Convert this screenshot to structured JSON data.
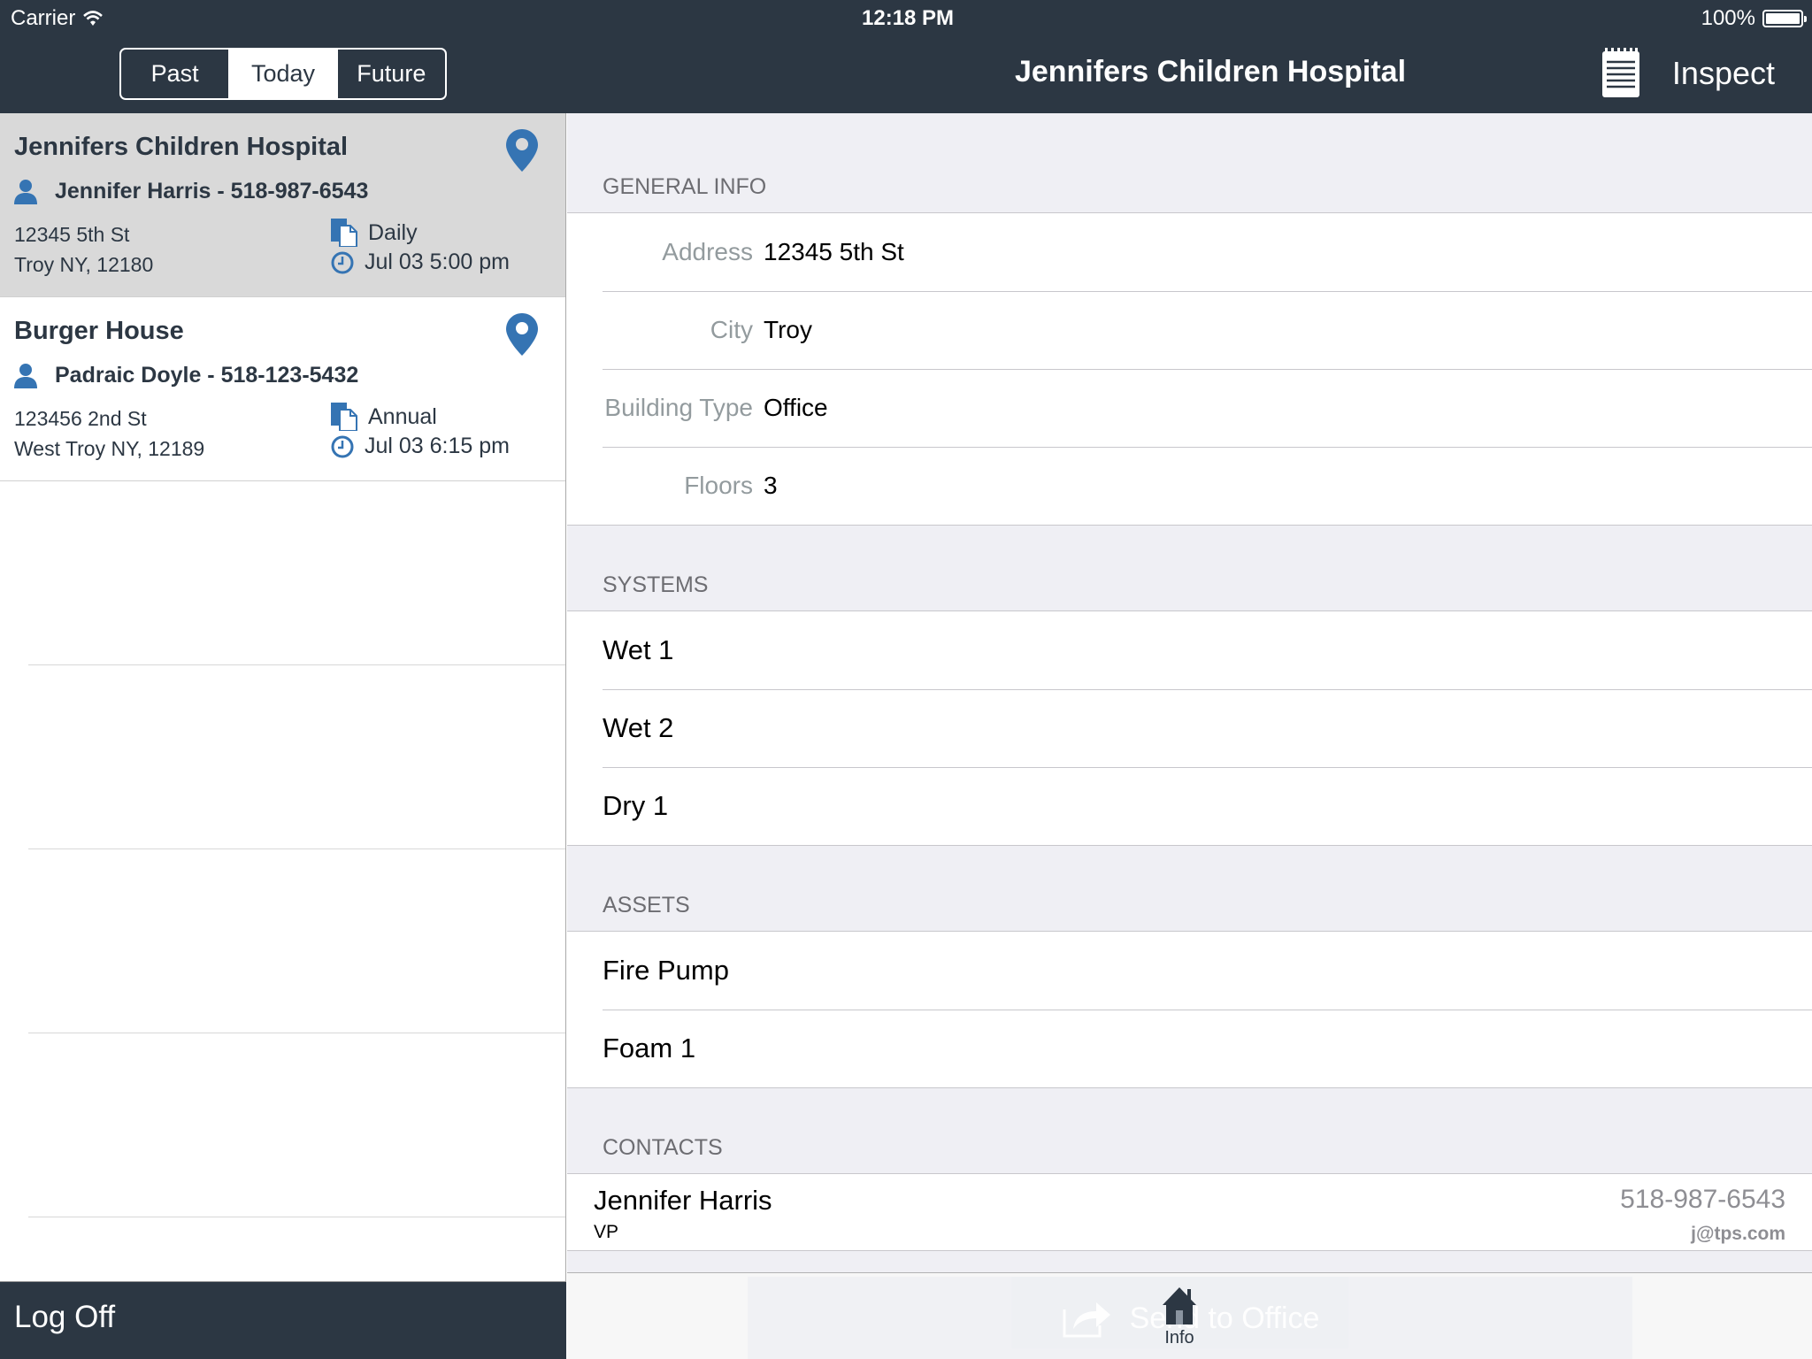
{
  "status_bar": {
    "carrier": "Carrier",
    "time": "12:18 PM",
    "battery": "100%"
  },
  "segmented": {
    "options": [
      "Past",
      "Today",
      "Future"
    ],
    "selected": "Today"
  },
  "nav": {
    "title": "Jennifers Children Hospital",
    "inspect_label": "Inspect"
  },
  "sidebar": {
    "items": [
      {
        "name": "Jennifers Children Hospital",
        "contact": "Jennifer Harris - 518-987-6543",
        "address1": "12345 5th St",
        "address2": "Troy NY, 12180",
        "frequency": "Daily",
        "due": "Jul 03 5:00 pm",
        "selected": true
      },
      {
        "name": "Burger House",
        "contact": "Padraic Doyle - 518-123-5432",
        "address1": "123456 2nd St",
        "address2": "West Troy NY, 12189",
        "frequency": "Annual",
        "due": "Jul 03 6:15 pm",
        "selected": false
      }
    ],
    "logoff_label": "Log Off"
  },
  "detail": {
    "general_info": {
      "header": "GENERAL INFO",
      "fields": [
        {
          "label": "Address",
          "value": "12345 5th St"
        },
        {
          "label": "City",
          "value": "Troy"
        },
        {
          "label": "Building Type",
          "value": "Office"
        },
        {
          "label": "Floors",
          "value": "3"
        }
      ]
    },
    "systems": {
      "header": "SYSTEMS",
      "items": [
        "Wet 1",
        "Wet 2",
        "Dry 1"
      ]
    },
    "assets": {
      "header": "ASSETS",
      "items": [
        "Fire Pump",
        "Foam 1"
      ]
    },
    "contacts": {
      "header": "CONTACTS",
      "items": [
        {
          "name": "Jennifer Harris",
          "role": "VP",
          "phone": "518-987-6543",
          "email": "j@tps.com"
        }
      ]
    }
  },
  "tabbar": {
    "send_label": "Send to Office",
    "info_label": "Info"
  },
  "colors": {
    "navbar": "#2c3743",
    "accent_blue": "#3574b3",
    "selected_row": "#d9d9d9",
    "grouped_bg": "#efeff4"
  }
}
